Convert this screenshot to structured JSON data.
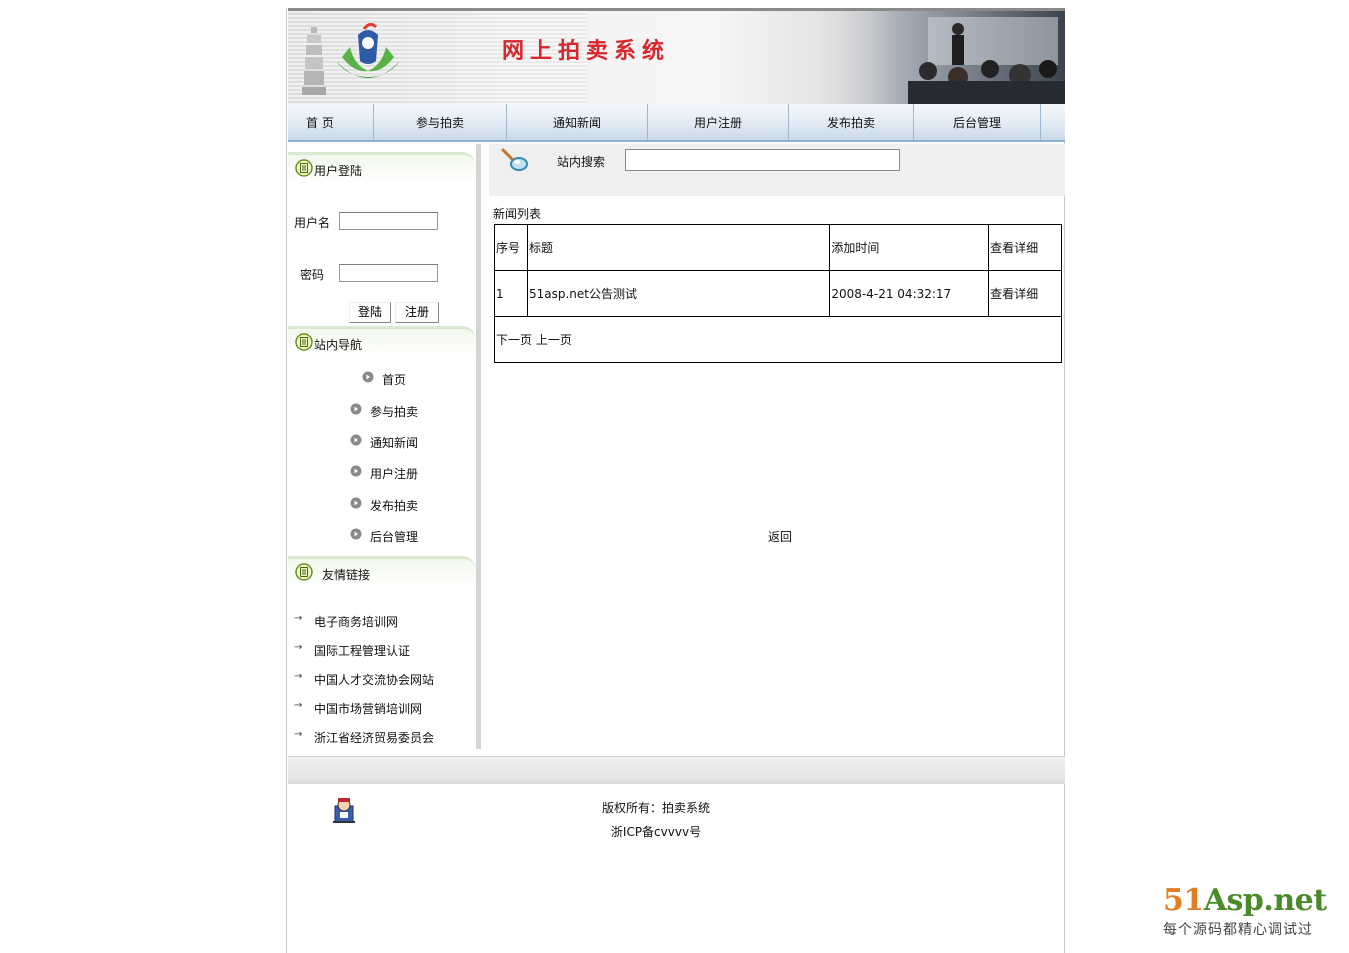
{
  "header": {
    "site_title": "网上拍卖系统"
  },
  "nav": {
    "items": [
      "首 页",
      "参与拍卖",
      "通知新闻",
      "用户注册",
      "发布拍卖",
      "后台管理"
    ]
  },
  "sidebar": {
    "login": {
      "title": "用户登陆",
      "username_label": "用户名",
      "password_label": "密码",
      "username_value": "",
      "password_value": "",
      "login_button": "登陆",
      "register_button": "注册"
    },
    "site_nav": {
      "title": "站内导航",
      "items": [
        "首页",
        "参与拍卖",
        "通知新闻",
        "用户注册",
        "发布拍卖",
        "后台管理"
      ]
    },
    "friend_links": {
      "title": "友情链接",
      "items": [
        "电子商务培训网",
        "国际工程管理认证",
        "中国人才交流协会网站",
        "中国市场营销培训网",
        "浙江省经济贸易委员会"
      ]
    }
  },
  "main": {
    "search": {
      "label": "站内搜索",
      "value": ""
    },
    "list_title": "新闻列表",
    "table": {
      "headers": [
        "序号",
        "标题",
        "添加时间",
        "查看详细"
      ],
      "rows": [
        [
          "1",
          "51asp.net公告测试",
          "2008-4-21 04:32:17",
          "查看详细"
        ]
      ],
      "pager_next": "下一页",
      "pager_prev": "上一页"
    },
    "back_link": "返回"
  },
  "footer": {
    "copyright": "版权所有：拍卖系统",
    "icp": "浙ICP备cvvvv号"
  },
  "watermark": {
    "brand_num": "51",
    "brand_rest": "Asp.net",
    "tagline": "每个源码都精心调试过"
  },
  "colors": {
    "title_red": "#d7262c",
    "nav_blue": "#dfe9f3",
    "panel_green": "#f2f8ec",
    "watermark_orange": "#e47c22",
    "watermark_green": "#4a8a2a"
  }
}
